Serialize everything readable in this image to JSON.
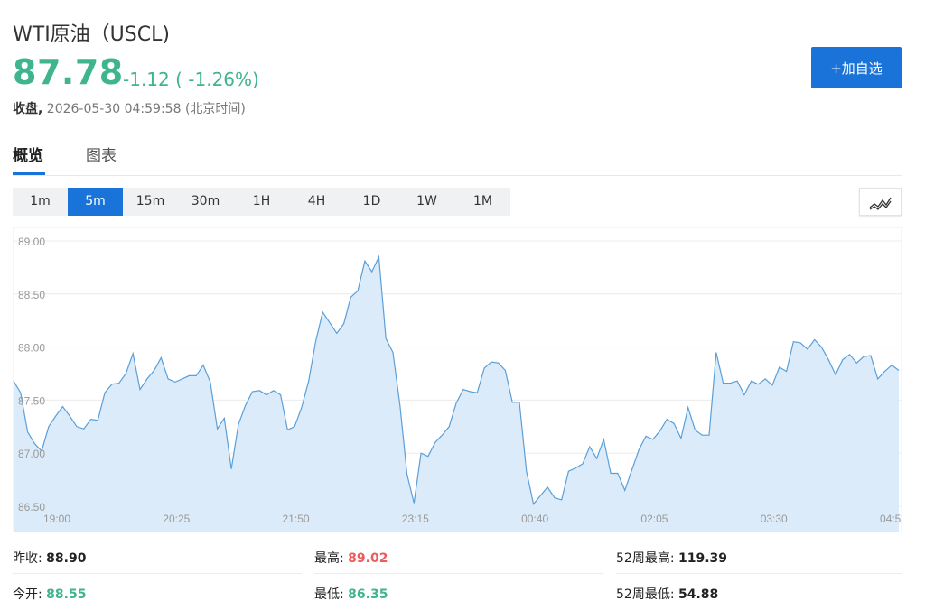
{
  "header": {
    "title": "WTI原油（USCL)",
    "price": "87.78",
    "change": "-1.12 ( -1.26%)",
    "status_label": "收盘,",
    "timestamp": "2026-05-30 04:59:58",
    "timezone": "(北京时间)",
    "add_button": "+加自选",
    "price_color": "#3fb48e",
    "button_color": "#1a73d9"
  },
  "tabs": [
    {
      "label": "概览",
      "active": true
    },
    {
      "label": "图表",
      "active": false
    }
  ],
  "intervals": [
    {
      "label": "1m",
      "active": false
    },
    {
      "label": "5m",
      "active": true
    },
    {
      "label": "15m",
      "active": false
    },
    {
      "label": "30m",
      "active": false
    },
    {
      "label": "1H",
      "active": false
    },
    {
      "label": "4H",
      "active": false
    },
    {
      "label": "1D",
      "active": false
    },
    {
      "label": "1W",
      "active": false
    },
    {
      "label": "1M",
      "active": false
    }
  ],
  "chart_type_icon": "line-chart-icon",
  "chart_data": {
    "type": "area",
    "title": "",
    "xlabel": "",
    "ylabel": "",
    "ylim": [
      86.5,
      89.0
    ],
    "y_ticks": [
      "89.00",
      "88.50",
      "88.00",
      "87.50",
      "87.00",
      "86.50"
    ],
    "x_ticks": [
      "19:00",
      "20:25",
      "21:50",
      "23:15",
      "00:40",
      "02:05",
      "03:30",
      "04:5"
    ],
    "x_tick_minutes": [
      0,
      85,
      170,
      255,
      340,
      425,
      510,
      595
    ],
    "x_range_minutes": [
      0,
      595
    ],
    "grid": true,
    "line_color": "#5a9fd8",
    "fill_color": "#dcebf9",
    "series": [
      {
        "values": [
          87.68,
          87.57,
          87.2,
          87.09,
          87.02,
          87.25,
          87.35,
          87.44,
          87.35,
          87.25,
          87.23,
          87.32,
          87.31,
          87.57,
          87.65,
          87.66,
          87.75,
          87.94,
          87.6,
          87.7,
          87.78,
          87.9,
          87.7,
          87.67,
          87.7,
          87.73,
          87.73,
          87.83,
          87.67,
          87.23,
          87.33,
          86.85,
          87.27,
          87.45,
          87.58,
          87.59,
          87.55,
          87.59,
          87.55,
          87.22,
          87.25,
          87.43,
          87.68,
          88.05,
          88.33,
          88.23,
          88.13,
          88.22,
          88.47,
          88.53,
          88.81,
          88.71,
          88.85,
          88.08,
          87.95,
          87.45,
          86.8,
          86.53,
          87.0,
          86.97,
          87.1,
          87.17,
          87.25,
          87.47,
          87.6,
          87.58,
          87.57,
          87.8,
          87.86,
          87.85,
          87.78,
          87.48,
          87.48,
          86.83,
          86.52,
          86.6,
          86.68,
          86.58,
          86.56,
          86.83,
          86.86,
          86.9,
          87.06,
          86.95,
          87.13,
          86.81,
          86.81,
          86.65,
          86.84,
          87.03,
          87.16,
          87.13,
          87.21,
          87.32,
          87.28,
          87.14,
          87.43,
          87.22,
          87.17,
          87.17,
          87.95,
          87.66,
          87.66,
          87.68,
          87.55,
          87.68,
          87.65,
          87.7,
          87.64,
          87.81,
          87.77,
          88.05,
          88.04,
          87.98,
          88.07,
          88.0,
          87.88,
          87.74,
          87.88,
          87.93,
          87.85,
          87.91,
          87.92,
          87.7,
          87.77,
          87.83,
          87.78
        ]
      }
    ]
  },
  "stats": [
    {
      "label": "昨收:",
      "value": "88.90",
      "tone": "plain"
    },
    {
      "label": "最高:",
      "value": "89.02",
      "tone": "up"
    },
    {
      "label": "52周最高:",
      "value": "119.39",
      "tone": "plain"
    },
    {
      "label": "今开:",
      "value": "88.55",
      "tone": "down"
    },
    {
      "label": "最低:",
      "value": "86.35",
      "tone": "up"
    },
    {
      "label": "52周最低:",
      "value": "54.88",
      "tone": "plain"
    }
  ]
}
